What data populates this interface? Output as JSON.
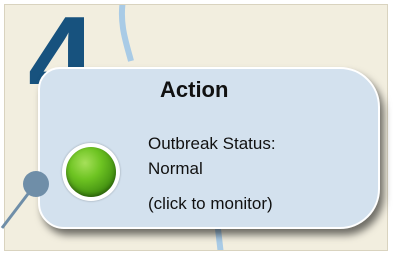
{
  "step": {
    "number": "4"
  },
  "card": {
    "title": "Action",
    "status_label": "Outbreak Status:",
    "status_value": "Normal",
    "monitor_link": "(click to monitor)"
  },
  "status_light": {
    "icon": "green-status-light-icon",
    "color": "#5fb51c"
  },
  "colors": {
    "step_number": "#17527e",
    "card_bg": "#d3e1ee",
    "map_bg": "#f2eedf",
    "river": "#a9cbe6",
    "connector": "#6f8ea8"
  }
}
